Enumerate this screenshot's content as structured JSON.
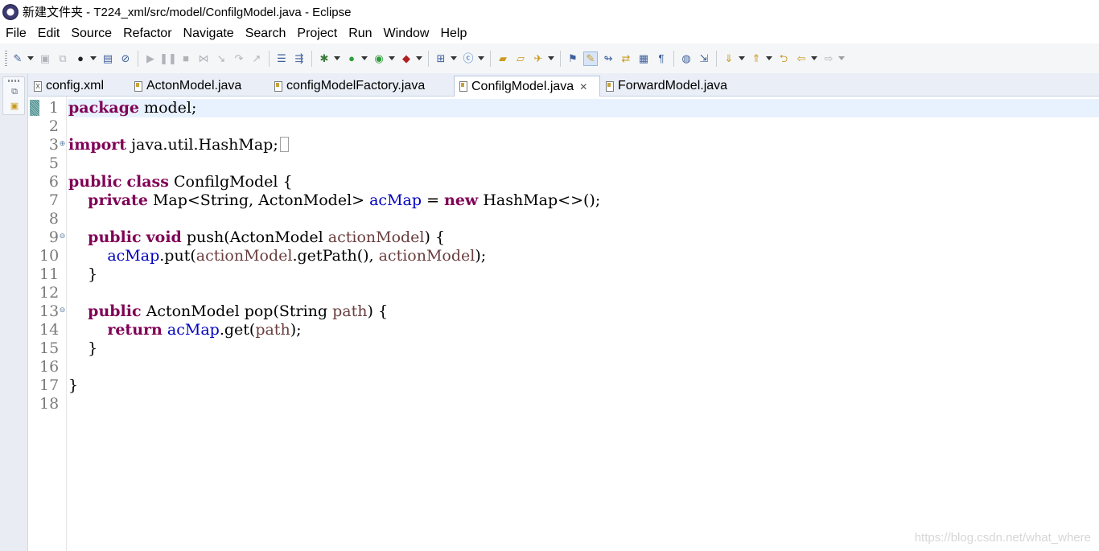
{
  "window": {
    "title": "新建文件夹 - T224_xml/src/model/ConfilgModel.java - Eclipse"
  },
  "menu": [
    "File",
    "Edit",
    "Source",
    "Refactor",
    "Navigate",
    "Search",
    "Project",
    "Run",
    "Window",
    "Help"
  ],
  "tabs": [
    {
      "label": "config.xml",
      "icon": "xml-file-icon"
    },
    {
      "label": "ActonModel.java",
      "icon": "java-file-icon"
    },
    {
      "label": "configModelFactory.java",
      "icon": "java-file-icon"
    },
    {
      "label": "ConfilgModel.java",
      "icon": "java-file-icon",
      "active": true,
      "close": "✕"
    },
    {
      "label": "ForwardModel.java",
      "icon": "java-file-icon"
    }
  ],
  "editor": {
    "line_numbers": [
      "1",
      "2",
      "3",
      "5",
      "6",
      "7",
      "8",
      "9",
      "10",
      "11",
      "12",
      "13",
      "14",
      "15",
      "16",
      "17",
      "18"
    ],
    "code": {
      "l1_kw": "package",
      "l1_rest": " model;",
      "l3_kw": "import",
      "l3_rest": " java.util.HashMap;",
      "l6_kw1": "public",
      "l6_kw2": "class",
      "l6_rest": " ConfilgModel {",
      "l7_kw": "private",
      "l7_type": " Map<String, ActonModel> ",
      "l7_field": "acMap",
      "l7_eq": " = ",
      "l7_new": "new",
      "l7_rest": " HashMap<>();",
      "l9_kw1": "public",
      "l9_kw2": "void",
      "l9_mid": " push(ActonModel ",
      "l9_param": "actionModel",
      "l9_rest": ") {",
      "l10_field": "acMap",
      "l10_mid": ".put(",
      "l10_param1": "actionModel",
      "l10_mid2": ".getPath(), ",
      "l10_param2": "actionModel",
      "l10_rest": ");",
      "l11": "}",
      "l13_kw": "public",
      "l13_mid": " ActonModel pop(String ",
      "l13_param": "path",
      "l13_rest": ") {",
      "l14_kw": "return",
      "l14_sp": " ",
      "l14_field": "acMap",
      "l14_mid": ".get(",
      "l14_param": "path",
      "l14_rest": ");",
      "l15": "}",
      "l17": "}"
    }
  },
  "watermark": "https://blog.csdn.net/what_where",
  "colors": {
    "keyword": "#7f0055",
    "field": "#0000c0",
    "parameter": "#6a3e3e",
    "current_line": "#e8f2fe"
  }
}
